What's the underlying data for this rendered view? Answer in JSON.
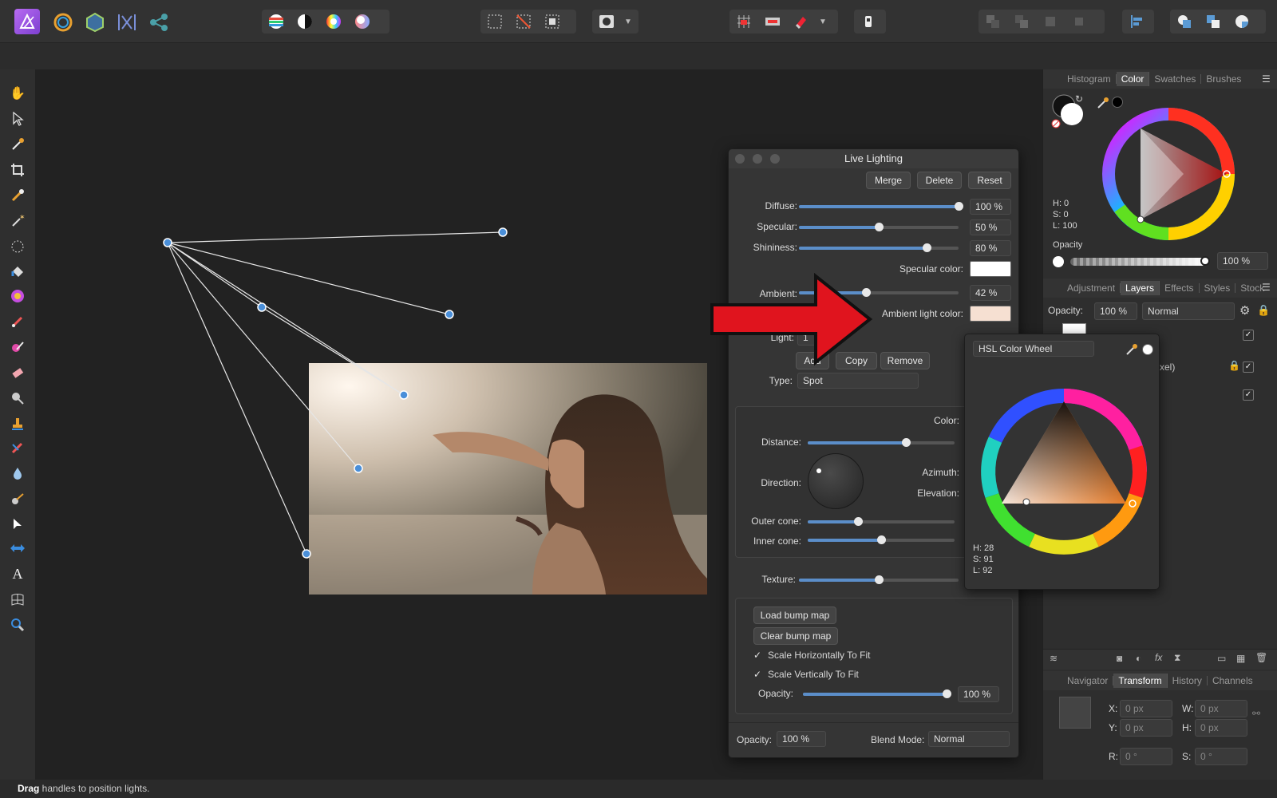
{
  "statusbar": {
    "bold": "Drag",
    "text": " handles to position lights."
  },
  "right": {
    "tabs1": [
      "Histogram",
      "Color",
      "Swatches",
      "Brushes"
    ],
    "tabs1_active": 1,
    "color": {
      "h": "H: 0",
      "s": "S: 0",
      "l": "L: 100",
      "opacity_label": "Opacity",
      "opacity_value": "100 %"
    },
    "tabs2": [
      "Adjustment",
      "Layers",
      "Effects",
      "Styles",
      "Stock"
    ],
    "tabs2_active": 1,
    "layers": {
      "opacity_label": "Opacity:",
      "opacity_value": "100 %",
      "blend": "Normal",
      "layer_partial": "xel)"
    },
    "tabs3": [
      "Navigator",
      "Transform",
      "History",
      "Channels"
    ],
    "tabs3_active": 1,
    "transform": {
      "x_label": "X:",
      "x": "0 px",
      "w_label": "W:",
      "w": "0 px",
      "y_label": "Y:",
      "y": "0 px",
      "h_label": "H:",
      "h": "0 px",
      "r_label": "R:",
      "r": "0 °",
      "s_label": "S:",
      "s": "0 °"
    }
  },
  "live_lighting": {
    "title": "Live Lighting",
    "buttons": {
      "merge": "Merge",
      "delete": "Delete",
      "reset": "Reset"
    },
    "diffuse": {
      "label": "Diffuse:",
      "value": "100 %",
      "level": 1.0
    },
    "specular": {
      "label": "Specular:",
      "value": "50 %",
      "level": 0.5
    },
    "shininess": {
      "label": "Shininess:",
      "value": "80 %",
      "level": 0.8
    },
    "specular_color_label": "Specular color:",
    "ambient": {
      "label": "Ambient:",
      "value": "42 %",
      "level": 0.42
    },
    "ambient_color_label": "Ambient light color:",
    "ambient_color": "#f6e0d2",
    "light_label": "Light:",
    "light_value": "1",
    "light_buttons": {
      "add": "Add",
      "copy": "Copy",
      "remove": "Remove"
    },
    "type_label": "Type:",
    "type_value": "Spot",
    "color_label": "Color:",
    "distance_label": "Distance:",
    "direction_label": "Direction:",
    "azimuth_label": "Azimuth:",
    "elevation_label": "Elevation:",
    "outer_cone_label": "Outer cone:",
    "inner_cone_label": "Inner cone:",
    "texture_label": "Texture:",
    "load_bump": "Load bump map",
    "clear_bump": "Clear bump map",
    "scale_h": "Scale Horizontally To Fit",
    "scale_v": "Scale Vertically To Fit",
    "opacity_label": "Opacity:",
    "opacity_value": "100 %",
    "footer_opacity_label": "Opacity:",
    "footer_opacity_value": "100 %",
    "blend_label": "Blend Mode:",
    "blend_value": "Normal"
  },
  "color_popup": {
    "mode": "HSL Color Wheel",
    "h": "H: 28",
    "s": "S: 91",
    "l": "L: 92"
  },
  "colors": {
    "accent": "#4a8fd9",
    "arrow": "#e0141e",
    "hue_red": "#ff2a2a",
    "orange": "#e37a28"
  }
}
